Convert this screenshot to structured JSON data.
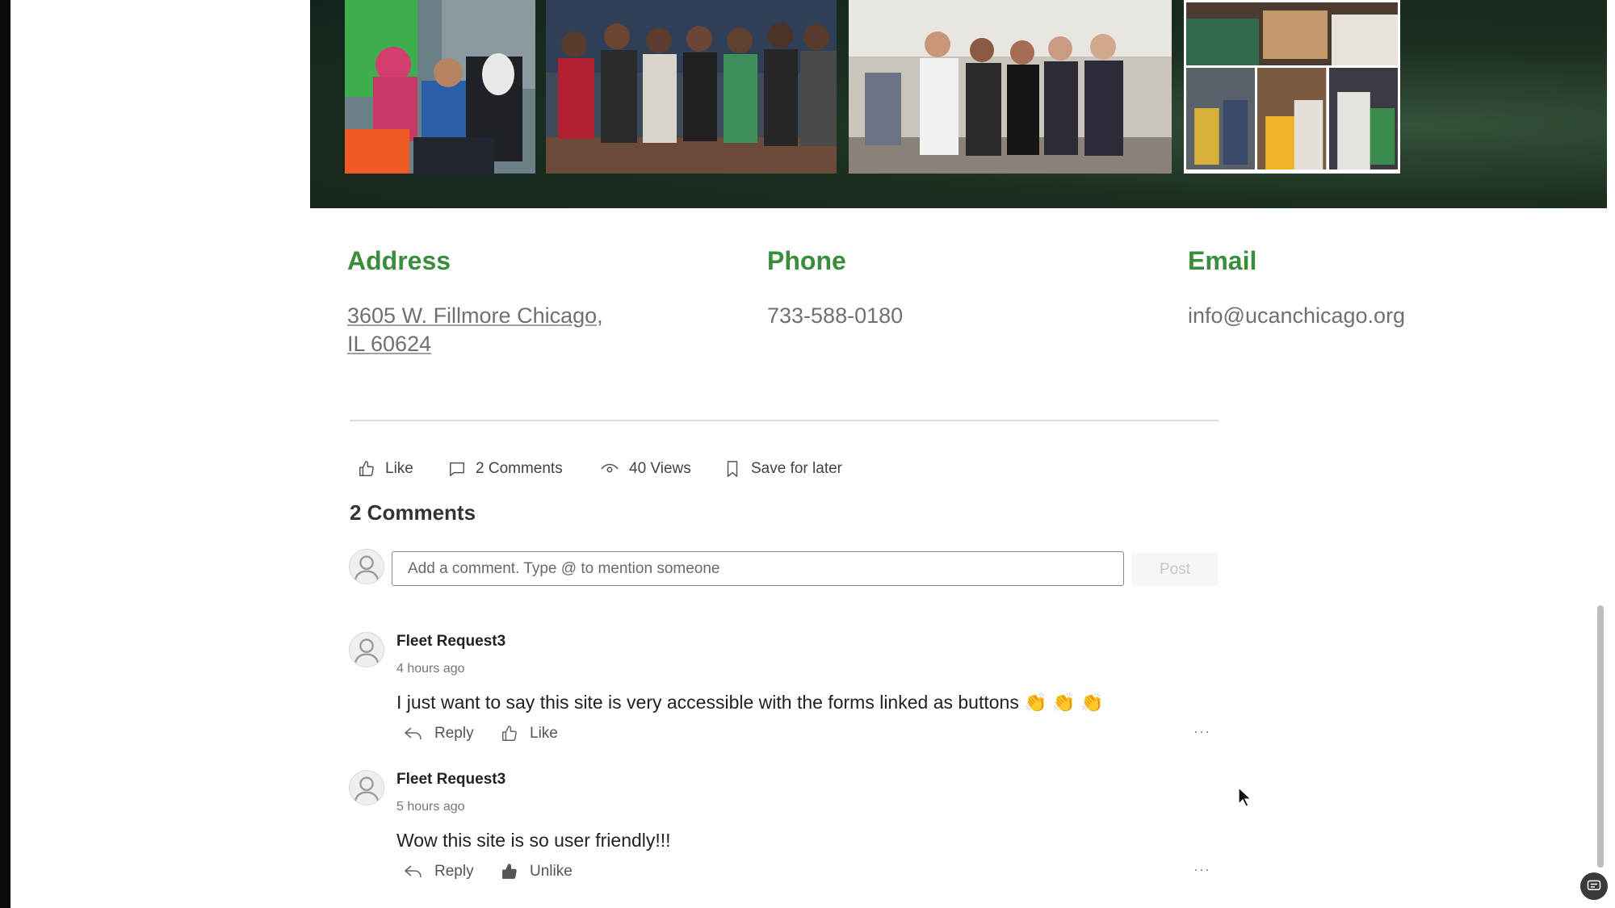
{
  "contact": {
    "address_heading": "Address",
    "address_line1": "3605 W. Fillmore Chicago,",
    "address_line2": "IL 60624",
    "phone_heading": "Phone",
    "phone": "733-588-0180",
    "email_heading": "Email",
    "email": "info@ucanchicago.org"
  },
  "post_actions": {
    "like": "Like",
    "comments": "2 Comments",
    "views": "40 Views",
    "save": "Save for later"
  },
  "comments_section": {
    "title": "2 Comments",
    "input_placeholder": "Add a comment. Type @ to mention someone",
    "post_button": "Post",
    "items": [
      {
        "author": "Fleet Request3",
        "time": "4 hours ago",
        "text": "I just want to say this site is very accessible with the forms linked as buttons 👏 👏 👏",
        "reply": "Reply",
        "like": "Like",
        "more": "···"
      },
      {
        "author": "Fleet Request3",
        "time": "5 hours ago",
        "text": "Wow this site is so user friendly!!!",
        "reply": "Reply",
        "like": "Unlike",
        "more": "···"
      }
    ]
  },
  "colors": {
    "accent_green": "#3a8d3a",
    "banner_dark": "#1b2e20"
  },
  "icons": [
    "thumbs-up-icon",
    "comment-icon",
    "eye-icon",
    "bookmark-icon",
    "reply-icon",
    "user-avatar-icon",
    "chat-icon"
  ]
}
